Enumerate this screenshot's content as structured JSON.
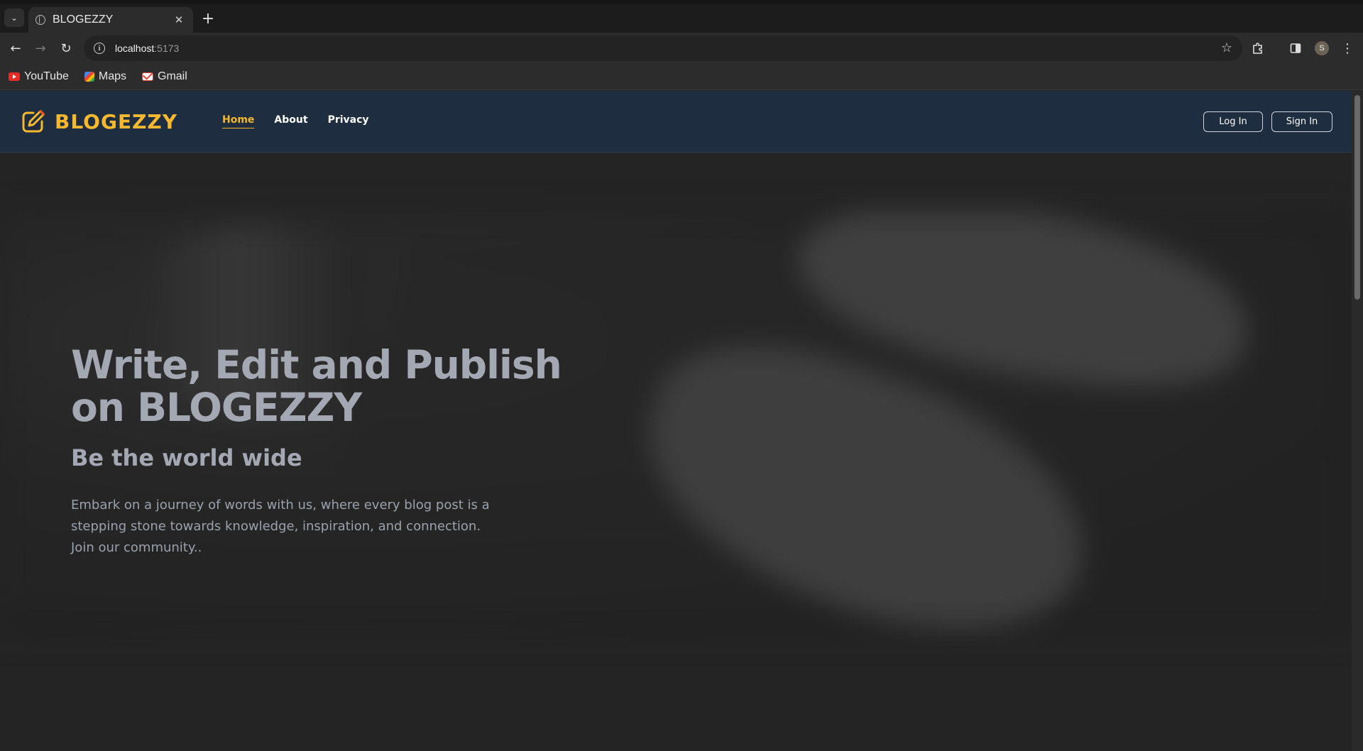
{
  "browser": {
    "tab_title": "BLOGEZZY",
    "url_host": "localhost",
    "url_port": ":5173",
    "profile_initial": "S",
    "bookmarks": [
      "YouTube",
      "Maps",
      "Gmail"
    ]
  },
  "site": {
    "brand": "BLOGEZZY",
    "brand_color": "#f5b82e",
    "nav_bg": "#1e2d40",
    "nav": [
      {
        "label": "Home",
        "active": true
      },
      {
        "label": "About",
        "active": false
      },
      {
        "label": "Privacy",
        "active": false
      }
    ],
    "login_label": "Log In",
    "signin_label": "Sign In"
  },
  "hero": {
    "title": "Write, Edit and Publish on BLOGEZZY",
    "subtitle": "Be the world wide",
    "body": "Embark on a journey of words with us, where every blog post is a stepping stone towards knowledge, inspiration, and connection. Join our community.."
  }
}
